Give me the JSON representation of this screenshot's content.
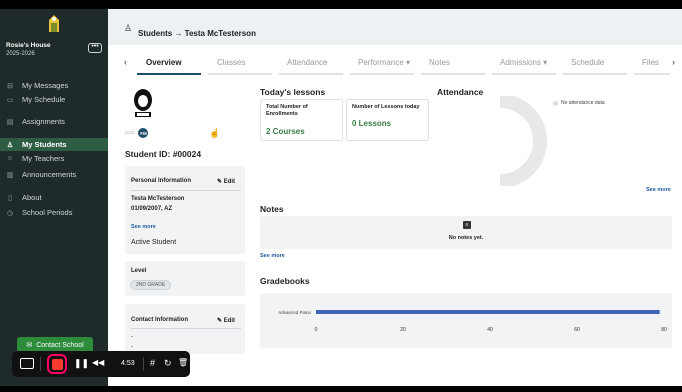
{
  "sidebar": {
    "school_name": "Rosie's House",
    "school_year": "2025-2026",
    "more_label": "•••",
    "items": [
      {
        "label": "My Messages",
        "icon": "⊟"
      },
      {
        "label": "My Schedule",
        "icon": "▭"
      },
      {
        "label": "Assignments",
        "icon": "▤"
      },
      {
        "label": "My Students",
        "icon": "♙"
      },
      {
        "label": "My Teachers",
        "icon": "☺"
      },
      {
        "label": "Announcements",
        "icon": "▥"
      },
      {
        "label": "About",
        "icon": "▯"
      },
      {
        "label": "School Periods",
        "icon": "◷"
      }
    ],
    "contact_button": "Contact School",
    "accent_color": "#2e5d44"
  },
  "header": {
    "breadcrumb": "Students → Testa McTesterson"
  },
  "tabs": [
    "Overview",
    "Classes",
    "Attendance",
    "Performance ▾",
    "Notes",
    "Admissions ▾",
    "Schedule",
    "Files"
  ],
  "tabs_nav": {
    "prev": "‹",
    "next": "›"
  },
  "student": {
    "initials": "FM",
    "id_label": "Student ID: #00024",
    "personal": {
      "title": "Personal Information",
      "edit": "✎ Edit",
      "name": "Testa McTesterson",
      "dob_state": "01/09/2007, AZ",
      "see_more": "See more",
      "status": "Active Student"
    },
    "level": {
      "title": "Level",
      "value": "2ND GRADE"
    },
    "contact": {
      "title": "Contact Information",
      "edit": "✎ Edit",
      "line1": "-",
      "line2": "-"
    }
  },
  "lessons": {
    "title": "Today's lessons",
    "enrollments_label": "Total Number of Enrollments",
    "enrollments_value": "2 Courses",
    "lessons_label": "Number of Lessons today",
    "lessons_value": "0 Lessons"
  },
  "attendance": {
    "title": "Attendance",
    "legend": "No attendance data",
    "see_more": "See more"
  },
  "notes": {
    "title": "Notes",
    "empty": "No notes yet.",
    "see_more": "See more"
  },
  "gradebooks": {
    "title": "Gradebooks",
    "ticks": [
      "0",
      "20",
      "40",
      "60",
      "80"
    ]
  },
  "chart_data": {
    "type": "bar",
    "categories": [
      "Advanced Piano"
    ],
    "values": [
      79
    ],
    "xlim": [
      0,
      80
    ],
    "title": "",
    "xlabel": "",
    "ylabel": ""
  },
  "recorder": {
    "time": "4:53",
    "pause": "❚❚",
    "rewind": "◀◀",
    "grid": "#",
    "refresh": "↻",
    "trash": "🗑"
  }
}
